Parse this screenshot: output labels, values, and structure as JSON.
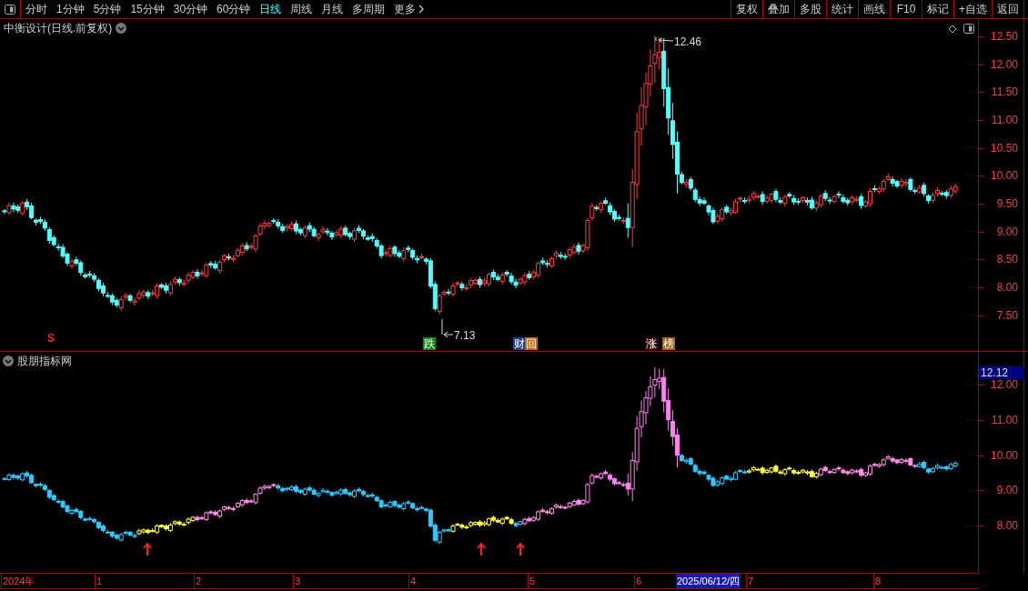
{
  "toolbar": {
    "periods": [
      {
        "label": "分时",
        "selected": false
      },
      {
        "label": "1分钟",
        "selected": false
      },
      {
        "label": "5分钟",
        "selected": false
      },
      {
        "label": "15分钟",
        "selected": false
      },
      {
        "label": "30分钟",
        "selected": false
      },
      {
        "label": "60分钟",
        "selected": false
      },
      {
        "label": "日线",
        "selected": true
      },
      {
        "label": "周线",
        "selected": false
      },
      {
        "label": "月线",
        "selected": false
      },
      {
        "label": "多周期",
        "selected": false
      },
      {
        "label": "更多",
        "selected": false
      }
    ],
    "actions": [
      "复权",
      "叠加",
      "多股",
      "统计",
      "画线",
      "F10",
      "标记",
      "+自选",
      "返回"
    ]
  },
  "main_panel": {
    "title": "中衡设计(日线.前复权)",
    "price_axis": [
      "12.50",
      "12.00",
      "11.50",
      "11.00",
      "10.50",
      "10.00",
      "9.50",
      "9.00",
      "8.50",
      "8.00",
      "7.50"
    ],
    "high_label": "12.46",
    "low_label": "7.13",
    "markers": [
      {
        "kind": "signal",
        "text": "S",
        "color": "#ff2020"
      },
      {
        "kind": "badge",
        "text": "跌",
        "color": "#138a13"
      },
      {
        "kind": "badge",
        "text": "财",
        "color": "#1c3f8c"
      },
      {
        "kind": "badge",
        "text": "回",
        "color": "#b86a14"
      },
      {
        "kind": "badge",
        "text": "涨",
        "color": "#3a0a0a"
      },
      {
        "kind": "badge",
        "text": "榜",
        "color": "#a0641e"
      }
    ]
  },
  "indicator_panel": {
    "title": "股朋指标网",
    "axis": [
      "12.00",
      "11.00",
      "10.00",
      "9.00",
      "8.00"
    ],
    "current_value": "12.12"
  },
  "time_axis": {
    "labels": [
      "2024年",
      "1",
      "2",
      "3",
      "4",
      "5",
      "6",
      "7",
      "8"
    ],
    "cursor_date": "2025/06/12/四"
  }
}
